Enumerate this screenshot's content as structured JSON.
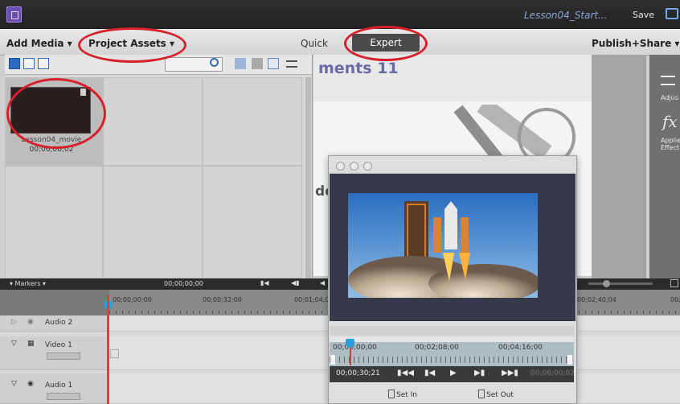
{
  "titlebar": {
    "document_title": "Lesson04_Start...",
    "save_label": "Save"
  },
  "menubar": {
    "add_media_label": "Add Media ▾",
    "project_assets_label": "Project Assets ▾",
    "quick_label": "Quick",
    "expert_label": "Expert",
    "publish_label": "Publish+Share ▾"
  },
  "assets": {
    "item_name": "Lesson04_movie",
    "item_duration": "00;06;00;02"
  },
  "preview": {
    "slide_title": "ments 11",
    "slide_fragment": "de"
  },
  "right_panel": {
    "adjust_label": "Adjus",
    "fx_label": "fx",
    "applied_effects_label": "Applie\nEffect"
  },
  "timeline": {
    "markers_label": "▾ Markers ▾",
    "header_time": "00;00;00;00",
    "ruler_times": [
      "00;00;00;00",
      "00;00;32;00",
      "00;01;04;0",
      "00;02;40;04",
      "00;"
    ],
    "tracks": [
      {
        "name": "Audio 2"
      },
      {
        "name": "Video 1"
      },
      {
        "name": "Audio 1"
      }
    ]
  },
  "clip_monitor": {
    "scrub_times": [
      "00;00;00;00",
      "00;02;08;00",
      "00;04;16;00"
    ],
    "current_time": "00;00;30;21",
    "end_time": "00;06;00;02",
    "set_in_label": "Set In",
    "set_out_label": "Set Out"
  },
  "colors": {
    "accent_red": "#d6212a",
    "title_blue": "#8aa6d6",
    "slide_purple": "#6a6aaa"
  }
}
